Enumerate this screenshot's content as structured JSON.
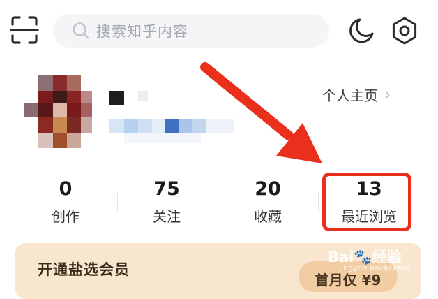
{
  "search": {
    "placeholder": "搜索知乎内容"
  },
  "icons": {
    "scan": "scan-icon",
    "search": "search-icon",
    "moon": "moon-icon",
    "gear": "gear-icon",
    "chevron": "chevron-right-icon"
  },
  "profile": {
    "homepage_link": "个人主页",
    "chevron": "›"
  },
  "stats": [
    {
      "value": "0",
      "label": "创作"
    },
    {
      "value": "75",
      "label": "关注"
    },
    {
      "value": "20",
      "label": "收藏"
    },
    {
      "value": "13",
      "label": "最近浏览"
    }
  ],
  "vip": {
    "title": "开通盐选会员",
    "price_button": "首月仅 ¥9"
  },
  "watermark": {
    "logo": "Bai🐾经验",
    "url": "jingyan.baidu.com"
  },
  "colors": {
    "annotation_red": "#ea2f1c",
    "vip_bg": "#f9e6cf",
    "search_bg": "#f4f5f7"
  }
}
